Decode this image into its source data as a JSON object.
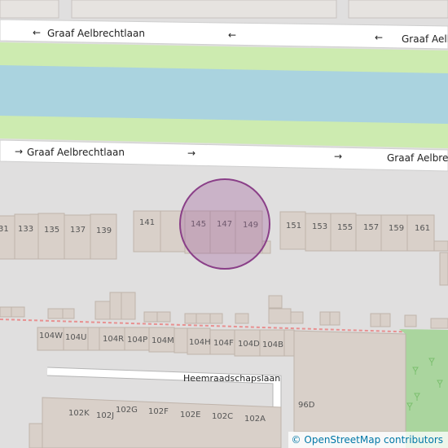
{
  "map": {
    "streets": {
      "north_label_left": "Graaf Aelbrechtlaan",
      "north_label_right": "Graaf Aelbrechtlaan",
      "south_label_left": "Graaf Aelbrechtlaan",
      "south_label_right": "Graaf Aelbrechtlaan",
      "bottom_street": "Heemraadschapslaan"
    },
    "oneway_arrow_left": "←",
    "oneway_arrow_right": "→",
    "arrow_left_label": "←",
    "house_numbers": {
      "row1": [
        "31",
        "133",
        "135",
        "137",
        "139",
        "141",
        "145",
        "147",
        "149",
        "151",
        "153",
        "155",
        "157",
        "159",
        "161"
      ],
      "row2": [
        "104W",
        "104U",
        "104R",
        "104P",
        "104M",
        "104H",
        "104F",
        "104D",
        "104B"
      ],
      "row3": [
        "102K",
        "102J",
        "102G",
        "102F",
        "102E",
        "102C",
        "102A"
      ],
      "other": "96D"
    },
    "marker": {
      "color": "#a0609e",
      "fill_opacity": 0.35
    },
    "colors": {
      "water": "#aad3df",
      "grass": "#cdebb0",
      "building": "#d9d0c9",
      "road": "#ffffff",
      "background": "#e0dfdf",
      "rail_dash": "#e89090",
      "park": "#aad59e"
    },
    "attribution": {
      "symbol": "©",
      "text": "OpenStreetMap contributors"
    }
  }
}
